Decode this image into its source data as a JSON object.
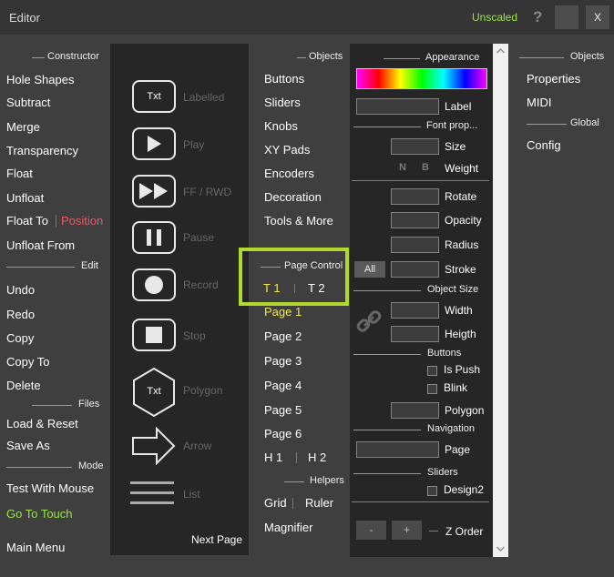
{
  "titlebar": {
    "title": "Editor",
    "unscaled": "Unscaled",
    "help": "?",
    "close": "X"
  },
  "left": {
    "constructor_header": "Constructor",
    "constructor": [
      "Hole Shapes",
      "Subtract",
      "Merge",
      "Transparency",
      "Float",
      "Unfloat"
    ],
    "float_to": "Float To",
    "position": "Position",
    "unfloat_from": "Unfloat From",
    "edit_header": "Edit",
    "edit": [
      "Undo",
      "Redo",
      "Copy",
      "Copy To",
      "Delete"
    ],
    "files_header": "Files",
    "files": [
      "Load & Reset",
      "Save As"
    ],
    "mode_header": "Mode",
    "mode": [
      "Test With Mouse",
      "Go To Touch"
    ],
    "main_menu": "Main Menu"
  },
  "palette": {
    "txt": "Txt",
    "items": [
      "Labelled",
      "Play",
      "FF / RWD",
      "Pause",
      "Record",
      "Stop",
      "Polygon",
      "Arrow",
      "List"
    ],
    "next_page": "Next Page"
  },
  "objects_col": {
    "header": "Objects",
    "items": [
      "Buttons",
      "Sliders",
      "Knobs",
      "XY Pads",
      "Encoders",
      "Decoration",
      "Tools & More"
    ],
    "page_control_header": "Page Control",
    "t1": "T 1",
    "t2": "T 2",
    "pages": [
      "Page 1",
      "Page 2",
      "Page 3",
      "Page 4",
      "Page 5",
      "Page 6"
    ],
    "h1": "H 1",
    "h2": "H 2",
    "helpers_header": "Helpers",
    "grid": "Grid",
    "ruler": "Ruler",
    "magnifier": "Magnifier"
  },
  "props": {
    "appearance": "Appearance",
    "label": "Label",
    "font_prop": "Font prop...",
    "size": "Size",
    "n": "N",
    "b": "B",
    "weight": "Weight",
    "rotate": "Rotate",
    "opacity": "Opacity",
    "radius": "Radius",
    "all": "All",
    "stroke": "Stroke",
    "object_size": "Object Size",
    "width": "Width",
    "heigth": "Heigth",
    "buttons_header": "Buttons",
    "is_push": "Is Push",
    "blink": "Blink",
    "polygon": "Polygon",
    "navigation_header": "Navigation",
    "page": "Page",
    "sliders_header": "Sliders",
    "design2": "Design2",
    "minus": "-",
    "plus": "+",
    "z_order": "Z Order"
  },
  "far_right": {
    "objects_header": "Objects",
    "properties": "Properties",
    "midi": "MIDI",
    "global_header": "Global",
    "config": "Config"
  },
  "colors": {
    "accent_green": "#9be24a",
    "pink": "#e05a66",
    "yellow": "#f2e84a",
    "highlight": "#b2d82e"
  }
}
